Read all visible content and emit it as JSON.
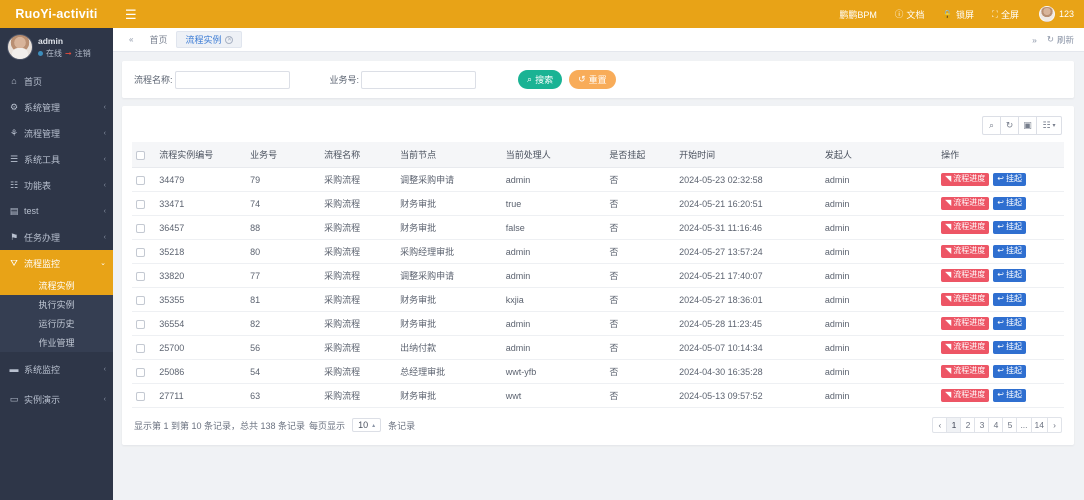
{
  "brand": {
    "logo_text": "RuoYi-activiti"
  },
  "topbar": {
    "menu_icon": "hamburger-icon",
    "items": [
      {
        "label": "鹏鹏BPM",
        "icon": ""
      },
      {
        "label": "文档",
        "icon": "?"
      },
      {
        "label": "锁屏",
        "icon": "■"
      },
      {
        "label": "全屏",
        "icon": "✖"
      }
    ],
    "username": "123"
  },
  "profile": {
    "name": "admin",
    "status": "在线",
    "logout": "注销"
  },
  "sidebar": {
    "items": [
      {
        "label": "首页",
        "icon": "⌂",
        "arrow": "",
        "active": false
      },
      {
        "label": "系统管理",
        "icon": "⚙",
        "arrow": "‹",
        "active": false
      },
      {
        "label": "流程管理",
        "icon": "⚘",
        "arrow": "‹",
        "active": false
      },
      {
        "label": "系统工具",
        "icon": "☰",
        "arrow": "‹",
        "active": false
      },
      {
        "label": "功能表",
        "icon": "☷",
        "arrow": "‹",
        "active": false
      },
      {
        "label": "test",
        "icon": "▤",
        "arrow": "‹",
        "active": false
      },
      {
        "label": "任务办理",
        "icon": "⚑",
        "arrow": "‹",
        "active": false
      },
      {
        "label": "流程监控",
        "icon": "⛛",
        "arrow": "⌄",
        "active": true
      }
    ],
    "submenu": [
      {
        "label": "流程实例",
        "active": true
      },
      {
        "label": "执行实例",
        "active": false
      },
      {
        "label": "运行历史",
        "active": false
      },
      {
        "label": "作业管理",
        "active": false
      }
    ],
    "items_after": [
      {
        "label": "系统监控",
        "icon": "▬",
        "arrow": "‹"
      },
      {
        "label": "实例演示",
        "icon": "▭",
        "arrow": "‹"
      }
    ]
  },
  "tabbar": {
    "prev_icon": "«",
    "tabs": [
      {
        "label": "首页",
        "active": false,
        "closable": false
      },
      {
        "label": "流程实例",
        "active": true,
        "closable": true
      }
    ],
    "next_icon": "»",
    "refresh_label": "刷新",
    "refresh_icon": "↻"
  },
  "search": {
    "name_label": "流程名称:",
    "name_value": "",
    "biz_label": "业务号:",
    "biz_value": "",
    "search_button": "搜索",
    "search_icon": "⌕",
    "reset_button": "重置",
    "reset_icon": "↺"
  },
  "toolbar": {
    "icons": [
      {
        "name": "search-icon",
        "glyph": "⌕"
      },
      {
        "name": "refresh-icon",
        "glyph": "↻"
      },
      {
        "name": "fullscreen-icon",
        "glyph": "▣"
      },
      {
        "name": "columns-icon",
        "glyph": "☷"
      }
    ],
    "columns_caret": "▾"
  },
  "table": {
    "columns": [
      "流程实例编号",
      "业务号",
      "流程名称",
      "当前节点",
      "当前处理人",
      "是否挂起",
      "开始时间",
      "发起人",
      "操作"
    ],
    "op_progress_label": "流程进度",
    "op_progress_icon": "◥",
    "op_suspend_label": "挂起",
    "op_suspend_icon": "↩",
    "rows": [
      {
        "id": "34479",
        "biz": "79",
        "name": "采购流程",
        "node": "调整采购申请",
        "handler": "admin",
        "suspended": "否",
        "start": "2024-05-23 02:32:58",
        "starter": "admin"
      },
      {
        "id": "33471",
        "biz": "74",
        "name": "采购流程",
        "node": "财务审批",
        "handler": "true",
        "suspended": "否",
        "start": "2024-05-21 16:20:51",
        "starter": "admin"
      },
      {
        "id": "36457",
        "biz": "88",
        "name": "采购流程",
        "node": "财务审批",
        "handler": "false",
        "suspended": "否",
        "start": "2024-05-31 11:16:46",
        "starter": "admin"
      },
      {
        "id": "35218",
        "biz": "80",
        "name": "采购流程",
        "node": "采购经理审批",
        "handler": "admin",
        "suspended": "否",
        "start": "2024-05-27 13:57:24",
        "starter": "admin"
      },
      {
        "id": "33820",
        "biz": "77",
        "name": "采购流程",
        "node": "调整采购申请",
        "handler": "admin",
        "suspended": "否",
        "start": "2024-05-21 17:40:07",
        "starter": "admin"
      },
      {
        "id": "35355",
        "biz": "81",
        "name": "采购流程",
        "node": "财务审批",
        "handler": "kxjia",
        "suspended": "否",
        "start": "2024-05-27 18:36:01",
        "starter": "admin"
      },
      {
        "id": "36554",
        "biz": "82",
        "name": "采购流程",
        "node": "财务审批",
        "handler": "admin",
        "suspended": "否",
        "start": "2024-05-28 11:23:45",
        "starter": "admin"
      },
      {
        "id": "25700",
        "biz": "56",
        "name": "采购流程",
        "node": "出纳付款",
        "handler": "admin",
        "suspended": "否",
        "start": "2024-05-07 10:14:34",
        "starter": "admin"
      },
      {
        "id": "25086",
        "biz": "54",
        "name": "采购流程",
        "node": "总经理审批",
        "handler": "wwt-yfb",
        "suspended": "否",
        "start": "2024-04-30 16:35:28",
        "starter": "admin"
      },
      {
        "id": "27711",
        "biz": "63",
        "name": "采购流程",
        "node": "财务审批",
        "handler": "wwt",
        "suspended": "否",
        "start": "2024-05-13 09:57:52",
        "starter": "admin"
      }
    ]
  },
  "pager": {
    "info_prefix": "显示第 1 到第 10 条记录，总共 138 条记录",
    "per_page_label": "每页显示",
    "per_page_value": "10",
    "per_page_caret": "▴",
    "records_suffix": "条记录",
    "pages": [
      "‹",
      "1",
      "2",
      "3",
      "4",
      "5",
      "...",
      "14",
      "›"
    ],
    "active_page": "1"
  },
  "colors": {
    "brand": "#e8a317",
    "sidebar": "#2e3648",
    "search_btn": "#1ab394",
    "reset_btn": "#f8ac59",
    "progress_btn": "#ed5565",
    "suspend_btn": "#2f6fd0"
  }
}
